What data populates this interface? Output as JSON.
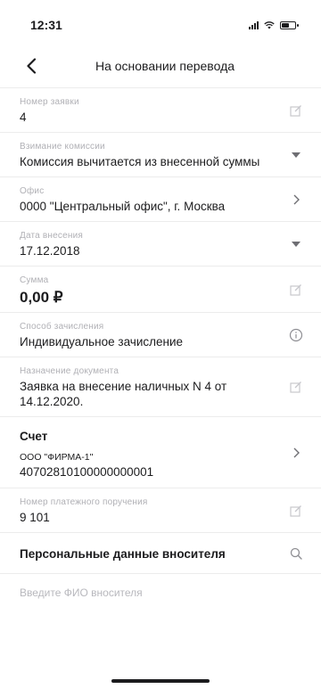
{
  "status": {
    "time": "12:31"
  },
  "nav": {
    "title": "На основании перевода"
  },
  "fields": [
    {
      "label": "Номер заявки",
      "value": "4",
      "icon": "edit-icon"
    },
    {
      "label": "Взимание комиссии",
      "value": "Комиссия вычитается из внесенной суммы",
      "icon": "dropdown-icon"
    },
    {
      "label": "Офис",
      "value": "0000 \"Центральный офис\", г. Москва",
      "icon": "chevron-right-icon"
    },
    {
      "label": "Дата внесения",
      "value": "17.12.2018",
      "icon": "dropdown-icon"
    },
    {
      "label": "Сумма",
      "value": "0,00 ₽",
      "icon": "edit-icon"
    },
    {
      "label": "Способ зачисления",
      "value": "Индивидуальное зачисление",
      "icon": "info-icon"
    },
    {
      "label": "Назначение документа",
      "value": "Заявка на внесение наличных N 4 от 14.12.2020.",
      "icon": "edit-icon"
    }
  ],
  "account": {
    "title": "Счет",
    "name": "ООО \"ФИРМА-1\"",
    "number": "40702810100000000001",
    "icon": "chevron-right-icon"
  },
  "payment_order": {
    "label": "Номер платежного поручения",
    "value": "9 101",
    "icon": "edit-icon"
  },
  "depositor": {
    "title": "Персональные данные вносителя",
    "icon": "search-icon",
    "placeholder": "Введите ФИО вносителя"
  }
}
